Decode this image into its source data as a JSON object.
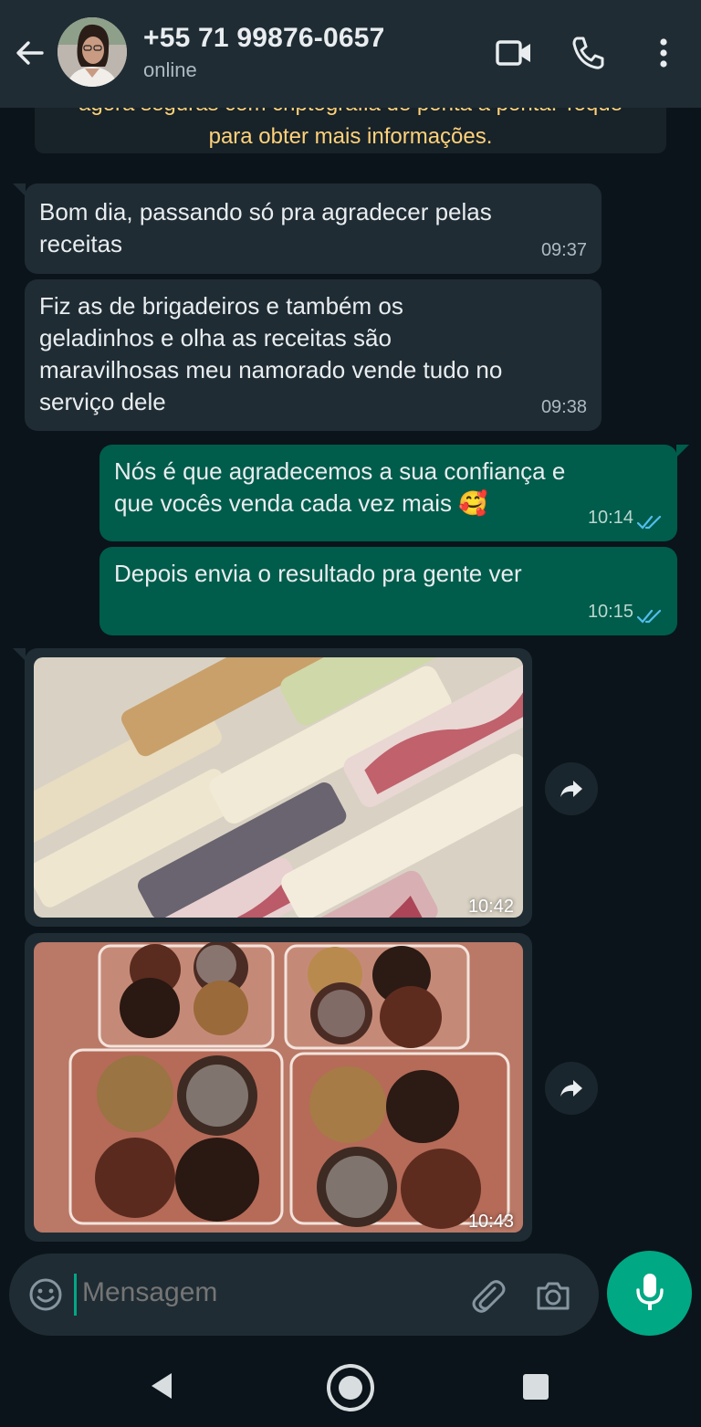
{
  "header": {
    "contact_name": "+55 71 99876-0657",
    "status": "online",
    "icons": [
      "back-arrow-icon",
      "video-call-icon",
      "voice-call-icon",
      "more-options-icon"
    ]
  },
  "encryption_notice": {
    "line1": "agora seguras com criptografia de ponta a ponta. Toque",
    "line2": "para obter mais informações."
  },
  "messages": [
    {
      "direction": "in",
      "text": "Bom dia, passando só pra agradecer pelas\nreceitas",
      "time": "09:37"
    },
    {
      "direction": "in",
      "text": "Fiz as de brigadeiros e também os\ngeladinhos e olha as receitas são\nmaravilhosas meu namorado vende tudo no\nserviço dele",
      "time": "09:38"
    },
    {
      "direction": "out",
      "text": "Nós é que agradecemos a sua confiança e\nque vocês venda cada vez mais 🥰",
      "time": "10:14",
      "read": true
    },
    {
      "direction": "out",
      "text": "Depois envia o resultado pra gente ver",
      "time": "10:15",
      "read": true
    },
    {
      "direction": "in",
      "type": "image",
      "subject": "geladinhos",
      "time": "10:42"
    },
    {
      "direction": "in",
      "type": "image",
      "subject": "brigadeiros",
      "time": "10:43"
    }
  ],
  "composer": {
    "placeholder": "Mensagem",
    "icons": [
      "emoji-icon",
      "attach-clip-icon",
      "camera-icon",
      "microphone-icon"
    ]
  },
  "colors": {
    "header_bg": "#1f2c34",
    "chat_bg": "#0b141a",
    "incoming_bubble": "#1f2c34",
    "outgoing_bubble": "#005c4b",
    "accent": "#00a884",
    "read_ticks": "#53bdeb",
    "notice_text": "#ffd279"
  },
  "navbar": {
    "icons": [
      "nav-back-icon",
      "nav-home-icon",
      "nav-recents-icon"
    ]
  }
}
